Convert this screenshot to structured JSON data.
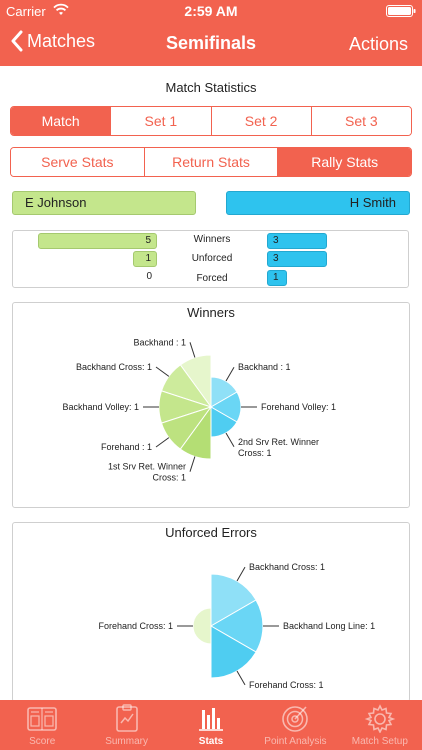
{
  "status_bar": {
    "carrier": "Carrier",
    "time": "2:59 AM"
  },
  "nav": {
    "back_label": "Matches",
    "title": "Semifinals",
    "action_label": "Actions"
  },
  "section_title": "Match Statistics",
  "period_tabs": [
    {
      "label": "Match",
      "active": true
    },
    {
      "label": "Set 1",
      "active": false
    },
    {
      "label": "Set 2",
      "active": false
    },
    {
      "label": "Set 3",
      "active": false
    }
  ],
  "stat_tabs": [
    {
      "label": "Serve Stats",
      "active": false
    },
    {
      "label": "Return Stats",
      "active": false
    },
    {
      "label": "Rally Stats",
      "active": true
    }
  ],
  "players": {
    "left": "E Johnson",
    "right": "H Smith"
  },
  "colors": {
    "accent": "#f2624f",
    "player_left": "#c4e68c",
    "player_right": "#2ec3ee"
  },
  "summary": [
    {
      "label": "Winners",
      "left": "5",
      "right": "3"
    },
    {
      "label": "Unforced",
      "left": "1",
      "right": "3"
    },
    {
      "label": "Forced",
      "left": "0",
      "right": "1"
    }
  ],
  "chart_data": [
    {
      "type": "pie",
      "title": "Winners",
      "series": [
        {
          "name": "E Johnson",
          "labels": [
            "Backhand : 1",
            "Backhand Cross: 1",
            "Backhand Volley: 1",
            "Forehand : 1",
            "1st Srv Ret. Winner Cross: 1"
          ],
          "values": [
            1,
            1,
            1,
            1,
            1
          ]
        },
        {
          "name": "H Smith",
          "labels": [
            "Backhand : 1",
            "Forehand Volley: 1",
            "2nd Srv Ret. Winner Cross: 1"
          ],
          "values": [
            1,
            1,
            1
          ]
        }
      ]
    },
    {
      "type": "pie",
      "title": "Unforced Errors",
      "series": [
        {
          "name": "E Johnson",
          "labels": [
            "Forehand Cross: 1"
          ],
          "values": [
            1
          ]
        },
        {
          "name": "H Smith",
          "labels": [
            "Backhand Cross: 1",
            "Backhand Long Line: 1",
            "Forehand Cross: 1"
          ],
          "values": [
            1,
            1,
            1
          ]
        }
      ]
    }
  ],
  "tabs": [
    {
      "label": "Score",
      "icon": "scoreboard-icon",
      "active": false
    },
    {
      "label": "Summary",
      "icon": "clipboard-icon",
      "active": false
    },
    {
      "label": "Stats",
      "icon": "bar-chart-icon",
      "active": true
    },
    {
      "label": "Point Analysis",
      "icon": "target-icon",
      "active": false
    },
    {
      "label": "Match Setup",
      "icon": "gear-icon",
      "active": false
    }
  ]
}
